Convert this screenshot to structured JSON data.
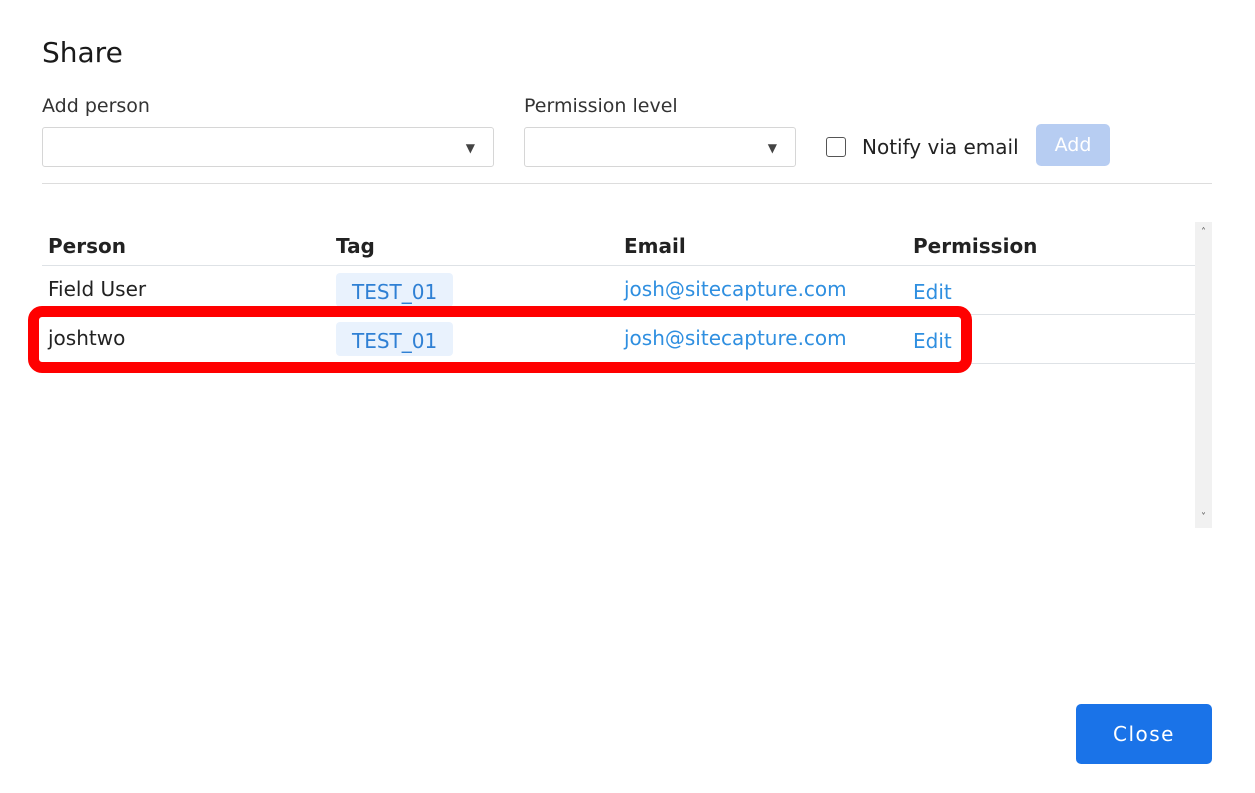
{
  "dialog": {
    "title": "Share"
  },
  "form": {
    "add_person_label": "Add person",
    "add_person_value": "",
    "permission_level_label": "Permission level",
    "permission_level_value": "",
    "notify_label": "Notify via email",
    "notify_checked": false,
    "add_button_label": "Add",
    "caret_glyph": "▼"
  },
  "table": {
    "headers": {
      "person": "Person",
      "tag": "Tag",
      "email": "Email",
      "permission": "Permission"
    },
    "rows": [
      {
        "person": "Field User",
        "tag": "TEST_01",
        "email": "josh@sitecapture.com",
        "permission": "Edit"
      },
      {
        "person": "joshtwo",
        "tag": "TEST_01",
        "email": "josh@sitecapture.com",
        "permission": "Edit"
      }
    ],
    "scroll_up_glyph": "˄",
    "scroll_down_glyph": "˅"
  },
  "footer": {
    "close_button_label": "Close"
  },
  "colors": {
    "primary": "#1a73e8",
    "primary_disabled": "#b7cdf2",
    "link": "#2f8fe0",
    "tag_bg": "#e9f2fd",
    "highlight": "#ff0000"
  }
}
